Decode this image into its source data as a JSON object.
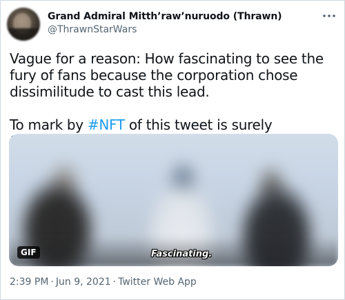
{
  "tweet": {
    "author": {
      "display_name": "Grand Admiral Mitth’raw’nuruodo (Thrawn)",
      "handle": "@ThrawnStarWars"
    },
    "more_icon": "ellipsis-horizontal-icon",
    "text": {
      "paragraph1": "Vague for a reason: How fascinating to see the fury of fans because the corporation chose dissimilitude to cast this lead.",
      "paragraph2_before": "To mark by ",
      "hashtag": "#NFT",
      "paragraph2_after": " of this tweet is surely fascinating."
    },
    "media": {
      "badge": "GIF",
      "caption": "Fascinating."
    },
    "meta": {
      "time": "2:39 PM",
      "separator1": "·",
      "date": "Jun 9, 2021",
      "separator2": "·",
      "source": "Twitter Web App"
    }
  },
  "colors": {
    "link_blue": "#1d9bf0",
    "secondary_text": "#536471",
    "primary_text": "#0f1419",
    "border": "#cfd9de"
  }
}
